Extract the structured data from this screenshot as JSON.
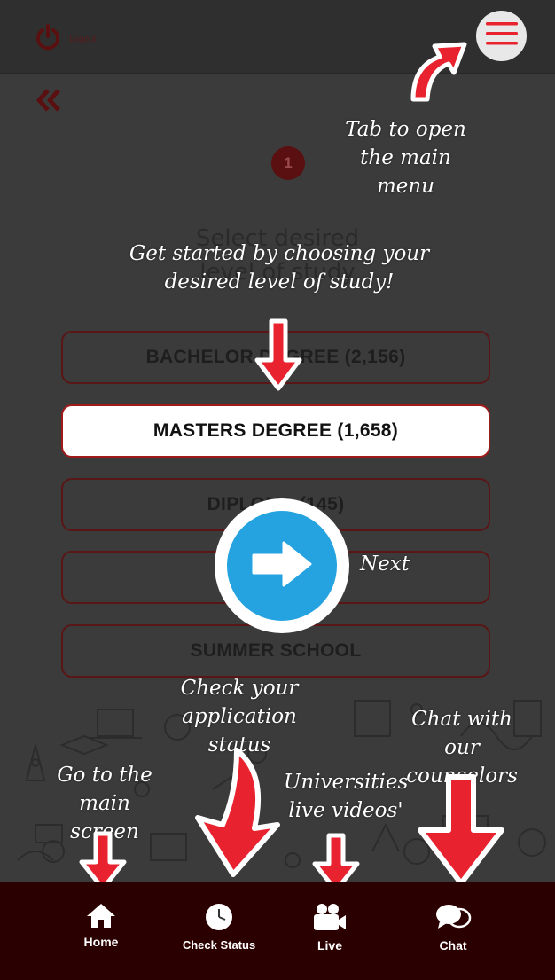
{
  "header": {
    "logout_label": "Logout"
  },
  "wizard": {
    "step_number": "1",
    "heading_line1": "Select desired",
    "heading_line2": "level of study"
  },
  "options": [
    {
      "label": "BACHELOR DEGREE (2,156)",
      "selected": false
    },
    {
      "label": "MASTERS DEGREE (1,658)",
      "selected": true
    },
    {
      "label": "DIPLOMA (145)",
      "selected": false
    },
    {
      "label": "",
      "selected": false
    },
    {
      "label": "SUMMER SCHOOL",
      "selected": false
    }
  ],
  "hints": {
    "menu": "Tab to open\nthe main menu",
    "level": "Get started by choosing your\ndesired level of study!",
    "next": "Next",
    "status": "Check your\napplication status",
    "chat": "Chat with\nour counselors",
    "home": "Go to the\nmain screen",
    "live": "Universities\nlive videos'"
  },
  "bottom_nav": [
    {
      "label": "Home",
      "icon": "home-icon"
    },
    {
      "label": "Check Status",
      "icon": "clock-icon"
    },
    {
      "label": "Live",
      "icon": "video-camera-icon"
    },
    {
      "label": "Chat",
      "icon": "chat-bubbles-icon"
    }
  ],
  "colors": {
    "accent_red": "#e8232f",
    "bottom_bar": "#2b0000",
    "next_blue": "#24a3e0"
  }
}
